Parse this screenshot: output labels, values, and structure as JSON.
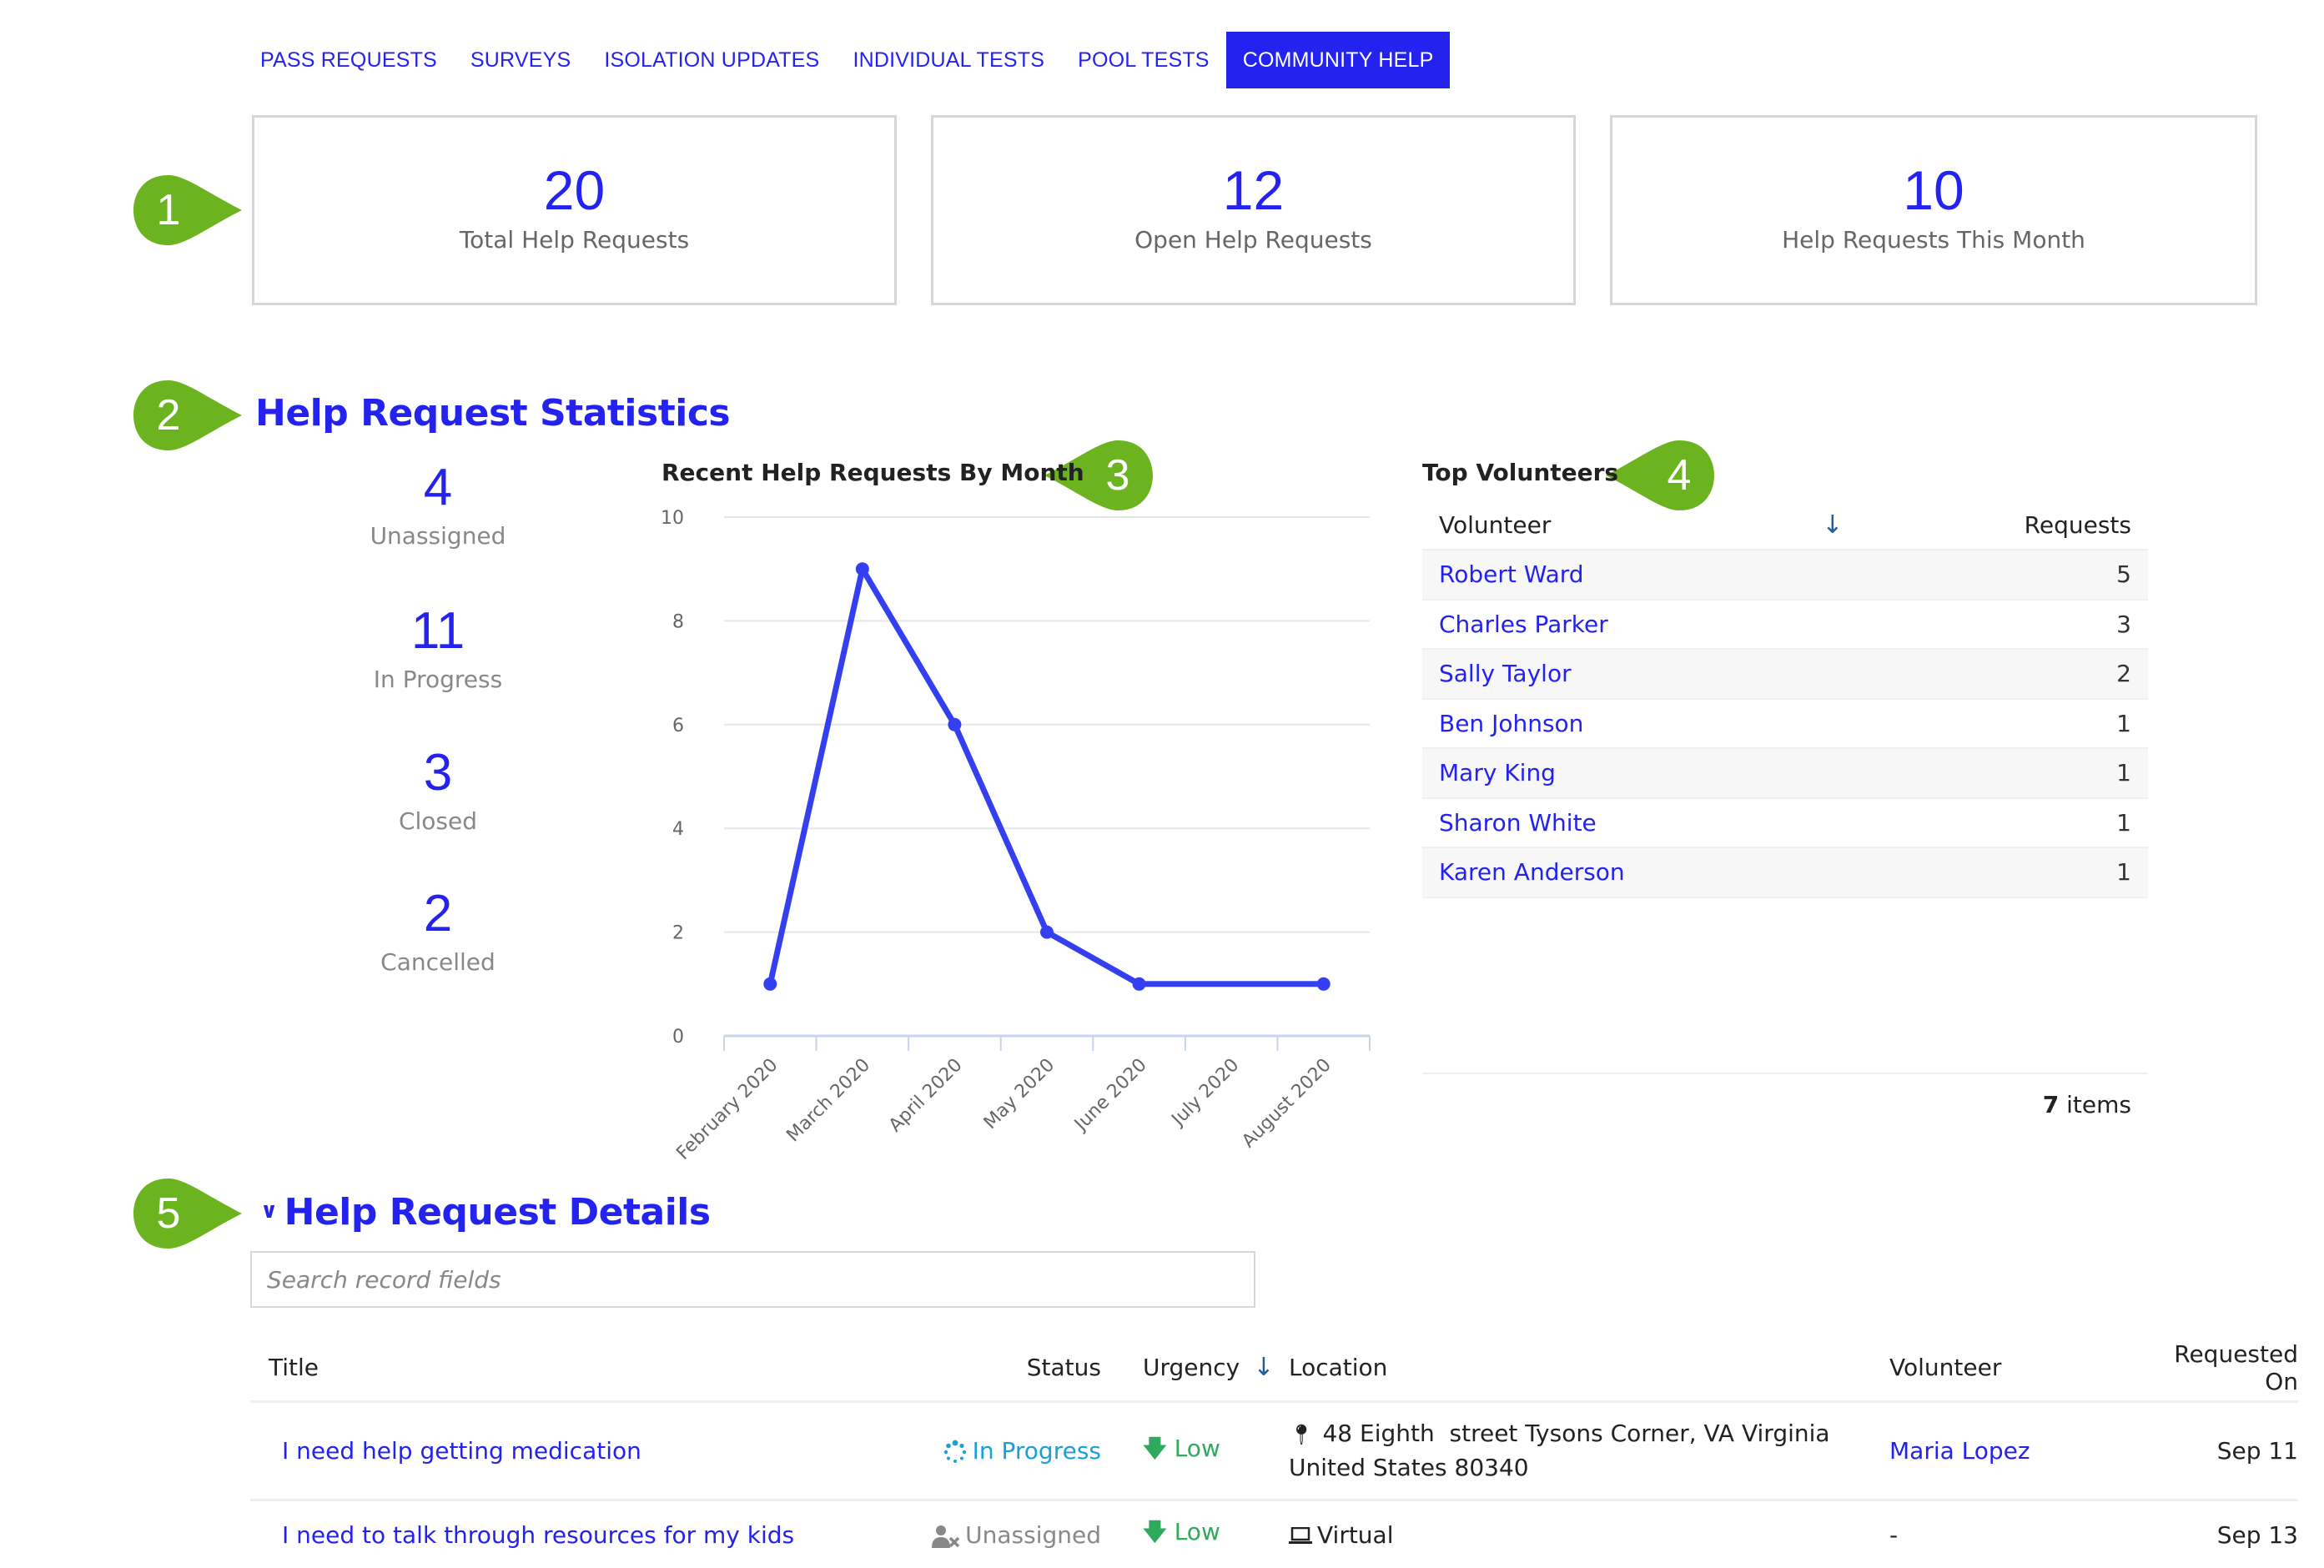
{
  "tabs": [
    {
      "label": "PASS REQUESTS",
      "active": false
    },
    {
      "label": "SURVEYS",
      "active": false
    },
    {
      "label": "ISOLATION UPDATES",
      "active": false
    },
    {
      "label": "INDIVIDUAL TESTS",
      "active": false
    },
    {
      "label": "POOL TESTS",
      "active": false
    },
    {
      "label": "COMMUNITY HELP",
      "active": true
    }
  ],
  "callouts": [
    "1",
    "2",
    "3",
    "4",
    "5"
  ],
  "kpis": [
    {
      "value": "20",
      "label": "Total Help Requests"
    },
    {
      "value": "12",
      "label": "Open Help Requests"
    },
    {
      "value": "10",
      "label": "Help Requests This Month"
    }
  ],
  "statistics": {
    "title": "Help Request Statistics",
    "status_counts": [
      {
        "value": "4",
        "label": "Unassigned"
      },
      {
        "value": "11",
        "label": "In Progress"
      },
      {
        "value": "3",
        "label": "Closed"
      },
      {
        "value": "2",
        "label": "Cancelled"
      }
    ]
  },
  "chart_data": {
    "type": "line",
    "title": "Recent Help Requests By Month",
    "xlabel": "",
    "ylabel": "",
    "categories": [
      "February 2020",
      "March 2020",
      "April 2020",
      "May 2020",
      "June 2020",
      "July 2020",
      "August 2020"
    ],
    "series": [
      {
        "name": "Help Requests",
        "values": [
          1,
          9,
          6,
          2,
          1,
          null,
          1
        ],
        "color": "#3440F0"
      }
    ],
    "ylim": [
      0,
      10
    ],
    "yticks": [
      0,
      2,
      4,
      6,
      8,
      10
    ],
    "grid": true,
    "legend": "none"
  },
  "top_volunteers": {
    "title": "Top Volunteers",
    "columns": [
      "Volunteer",
      "Requests"
    ],
    "sort_icon": "arrow-down-icon",
    "rows": [
      {
        "name": "Robert Ward",
        "requests": "5"
      },
      {
        "name": "Charles Parker",
        "requests": "3"
      },
      {
        "name": "Sally Taylor",
        "requests": "2"
      },
      {
        "name": "Ben Johnson",
        "requests": "1"
      },
      {
        "name": "Mary King",
        "requests": "1"
      },
      {
        "name": "Sharon White",
        "requests": "1"
      },
      {
        "name": "Karen Anderson",
        "requests": "1"
      }
    ],
    "total_count": "7",
    "total_suffix": " items"
  },
  "details": {
    "title": "Help Request Details",
    "search_placeholder": "Search record fields",
    "search_value": "",
    "columns": {
      "title": "Title",
      "status": "Status",
      "urgency": "Urgency",
      "location": "Location",
      "volunteer": "Volunteer",
      "requested_on": "Requested On"
    },
    "rows": [
      {
        "title": "I need help getting medication",
        "status": "In Progress",
        "status_icon": "spinner-icon",
        "urgency": "Low",
        "urgency_icon": "arrow-down-icon",
        "location_icon": "map-marker-icon",
        "location_line1": "48 Eighth  street Tysons Corner, VA Virginia",
        "location_line2": "United States 80340",
        "volunteer": "Maria Lopez",
        "requested_on": "Sep 11"
      },
      {
        "title": "I need to talk through resources for my kids",
        "status": "Unassigned",
        "status_icon": "user-times-icon",
        "urgency": "Low",
        "urgency_icon": "arrow-down-icon",
        "location_icon": "laptop-icon",
        "location_line1": "Virtual",
        "location_line2": "",
        "volunteer": "-",
        "requested_on": "Sep 13"
      }
    ]
  },
  "colors": {
    "accent": "#2322EE",
    "callout": "#6BB31F",
    "chart_line": "#3440F0",
    "in_progress": "#1AA0D8",
    "urgency_low": "#2EAA5C",
    "sort_arrow": "#1F5F9E"
  }
}
